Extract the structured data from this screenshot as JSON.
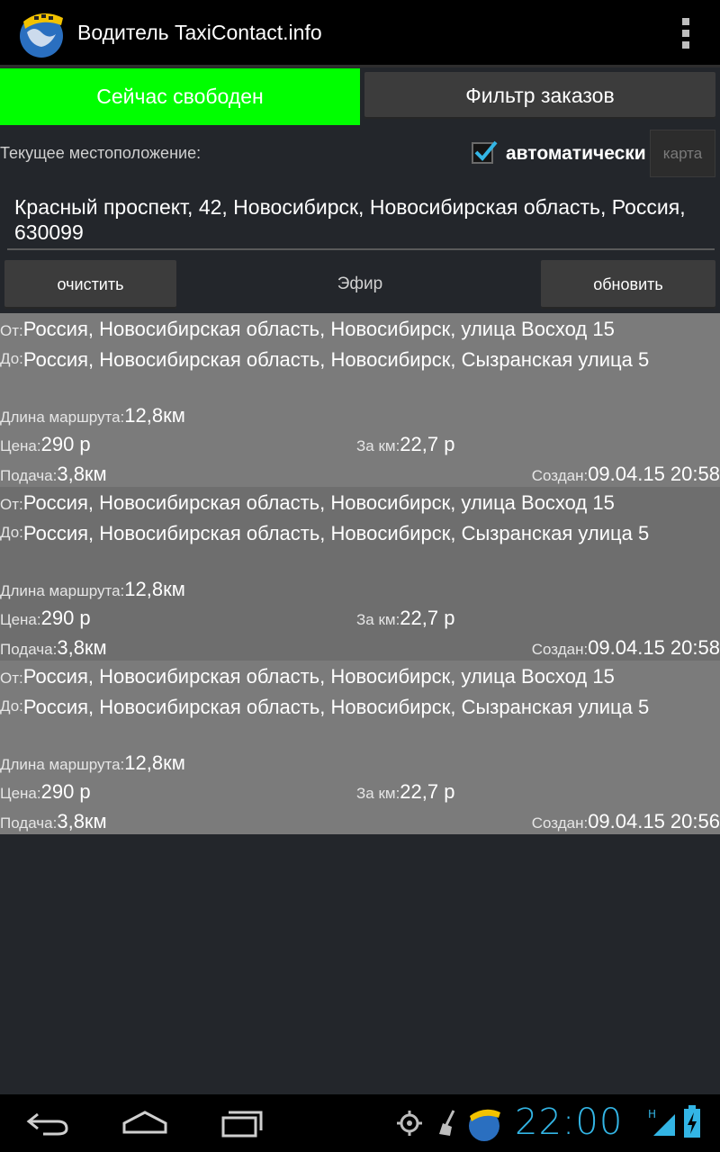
{
  "app": {
    "title": "Водитель TaxiContact.info"
  },
  "controls": {
    "status_button": "Сейчас свободен",
    "filter_button": "Фильтр заказов",
    "location_label": "Текущее местоположение:",
    "auto_label": "автоматически",
    "auto_checked": true,
    "map_button": "карта",
    "address": "Красный проспект, 42, Новосибирск, Новосибирская область, Россия, 630099",
    "clear_button": "очистить",
    "air_label": "Эфир",
    "refresh_button": "обновить"
  },
  "labels": {
    "from": "От:",
    "to": "До:",
    "length": "Длина маршрута:",
    "price": "Цена:",
    "per_km": "За км:",
    "pickup": "Подача:",
    "created": "Создан:"
  },
  "orders": [
    {
      "from": "Россия, Новосибирская область, Новосибирск, улица Восход 15",
      "to": "Россия, Новосибирская область, Новосибирск, Сызранская улица 5",
      "length": "12,8км",
      "price": "290 р",
      "per_km": "22,7 р",
      "pickup": "3,8км",
      "created": "09.04.15 20:58"
    },
    {
      "from": "Россия, Новосибирская область, Новосибирск, улица Восход 15",
      "to": "Россия, Новосибирская область, Новосибирск, Сызранская улица 5",
      "length": "12,8км",
      "price": "290 р",
      "per_km": "22,7 р",
      "pickup": "3,8км",
      "created": "09.04.15 20:58"
    },
    {
      "from": "Россия, Новосибирская область, Новосибирск, улица Восход 15",
      "to": "Россия, Новосибирская область, Новосибирск, Сызранская улица 5",
      "length": "12,8км",
      "price": "290 р",
      "per_km": "22,7 р",
      "pickup": "3,8км",
      "created": "09.04.15 20:56"
    }
  ],
  "system": {
    "clock": "22:00",
    "icons": [
      "back-icon",
      "home-icon",
      "recent-apps-icon",
      "gps-icon",
      "broom-icon",
      "app-notification-icon",
      "signal-icon",
      "battery-icon"
    ]
  },
  "colors": {
    "status_green": "#00ff00",
    "clock_blue": "#33b5e5",
    "checkbox_blue": "#33b5e5"
  }
}
